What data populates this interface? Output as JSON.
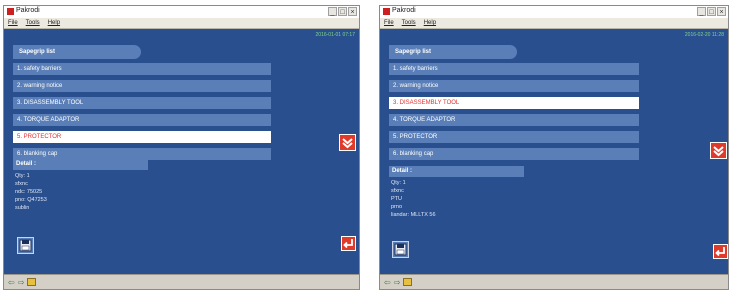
{
  "windows": [
    {
      "title": "Pakrodi",
      "menu": [
        "File",
        "Tools",
        "Help"
      ],
      "datetime": "2016-01-01 07:17",
      "header": "Sapegrip list",
      "items": [
        "1. safety barriers",
        "2. warning notice",
        "3. DISASSEMBLY TOOL",
        "4. TORQUE ADAPTOR",
        "5. PROTECTOR",
        "6. blanking cap"
      ],
      "selected_index": 4,
      "detail_title": "Detail :",
      "detail_lines": [
        "Qty: 1",
        "sfxnc",
        "ndc: 75025",
        "pno: Q47253",
        "sublin"
      ]
    },
    {
      "title": "Pakrodi",
      "menu": [
        "File",
        "Tools",
        "Help"
      ],
      "datetime": "2016-02-20 11:28",
      "header": "Sapegrip list",
      "items": [
        "1. safety barriers",
        "2. warning notice",
        "3. DISASSEMBLY TOOL",
        "4. TORQUE ADAPTOR",
        "5. PROTECTOR",
        "6. blanking cap"
      ],
      "selected_index": 2,
      "detail_title": "Detail :",
      "detail_lines": [
        "Qty: 1",
        "sfxnc",
        "PTU",
        "prno",
        "liandar: MLLTX 56"
      ]
    }
  ],
  "icons": {
    "down": "down-arrow-icon",
    "enter": "enter-icon",
    "save": "save-disk-icon",
    "back": "back-arrow-icon",
    "forward": "forward-arrow-icon",
    "folder": "folder-icon"
  },
  "colors": {
    "background": "#2a4f8f",
    "item": "#5a7fb8",
    "selected_text": "#e03030",
    "accent_red": "#e03a2a"
  }
}
